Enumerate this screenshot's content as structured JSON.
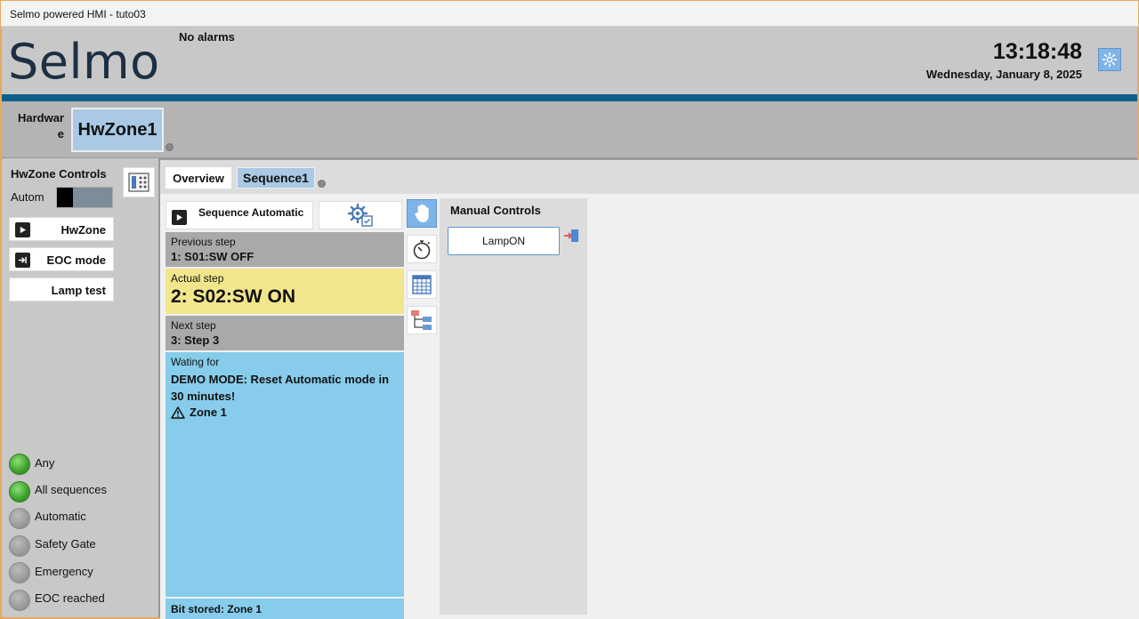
{
  "window": {
    "title": "Selmo powered HMI - tuto03"
  },
  "header": {
    "logo": "Selmo",
    "alarms": "No alarms",
    "time": "13:18:48",
    "date": "Wednesday, January 8, 2025",
    "settings_icon": "gear-icon"
  },
  "zones": {
    "label_line1": "Hardwar",
    "label_line2": "e",
    "active_zone": "HwZone1"
  },
  "left_panel": {
    "title": "HwZone Controls",
    "autom_label": "Autom",
    "buttons": [
      {
        "label": "HwZone",
        "icon": "play-icon"
      },
      {
        "label": "EOC mode",
        "icon": "arrow-to-line-icon"
      },
      {
        "label": "Lamp test",
        "icon": ""
      }
    ],
    "lamps": [
      {
        "label": "Any",
        "state": "on"
      },
      {
        "label": "All sequences",
        "state": "on"
      },
      {
        "label": "Automatic",
        "state": "off"
      },
      {
        "label": "Safety Gate",
        "state": "off"
      },
      {
        "label": "Emergency",
        "state": "off"
      },
      {
        "label": "EOC reached",
        "state": "off"
      }
    ]
  },
  "tabs": [
    {
      "label": "Overview",
      "active": false
    },
    {
      "label": "Sequence1",
      "active": true
    }
  ],
  "sequence": {
    "automatic_button": "Sequence Automatic",
    "previous": {
      "label": "Previous step",
      "value": "1: S01:SW OFF"
    },
    "actual": {
      "label": "Actual step",
      "value": "2: S02:SW ON"
    },
    "next": {
      "label": "Next step",
      "value": "3: Step 3"
    },
    "waiting": {
      "label": "Wating for",
      "value": "DEMO MODE: Reset Automatic mode in 30 minutes!",
      "zone": "Zone 1"
    },
    "bit_stored": "Bit stored: Zone 1"
  },
  "tools": [
    "hand-icon",
    "stopwatch-icon",
    "grid-icon",
    "tree-icon"
  ],
  "manual_controls": {
    "title": "Manual Controls",
    "buttons": [
      {
        "label": "LampON"
      }
    ]
  },
  "colors": {
    "accent_blue": "#105e8a",
    "actual_step": "#f2e68c",
    "waiting": "#87cdeb",
    "tab_active": "#a9c9e4",
    "lamp_on": "#3ba02a"
  }
}
